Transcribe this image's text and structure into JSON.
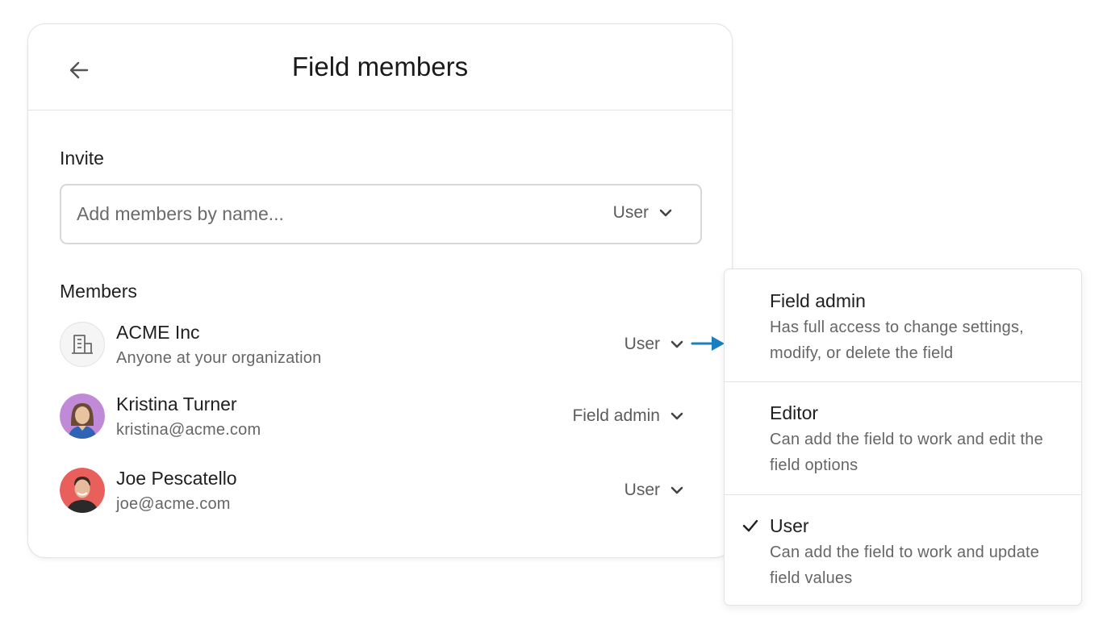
{
  "header": {
    "title": "Field members"
  },
  "invite": {
    "label": "Invite",
    "placeholder": "Add members by name...",
    "role": "User"
  },
  "members": {
    "label": "Members",
    "items": [
      {
        "name": "ACME Inc",
        "sub": "Anyone at your organization",
        "role": "User"
      },
      {
        "name": "Kristina Turner",
        "sub": "kristina@acme.com",
        "role": "Field admin"
      },
      {
        "name": "Joe Pescatello",
        "sub": "joe@acme.com",
        "role": "User"
      }
    ]
  },
  "role_menu": {
    "options": [
      {
        "title": "Field admin",
        "desc": "Has full access to change settings, modify, or delete the field",
        "selected": false
      },
      {
        "title": "Editor",
        "desc": "Can add the field to work and edit the field options",
        "selected": false
      },
      {
        "title": "User",
        "desc": "Can add the field to work and update field values",
        "selected": true
      }
    ]
  },
  "colors": {
    "accent_arrow": "#1a7fc1",
    "avatar_kristina_bg": "#c08ad8",
    "avatar_joe_bg": "#e85f5c"
  },
  "icons": {
    "back": "arrow-left-icon",
    "org": "building-icon",
    "chevron": "chevron-down-icon",
    "check": "checkmark-icon",
    "pointer": "arrow-right-icon"
  }
}
